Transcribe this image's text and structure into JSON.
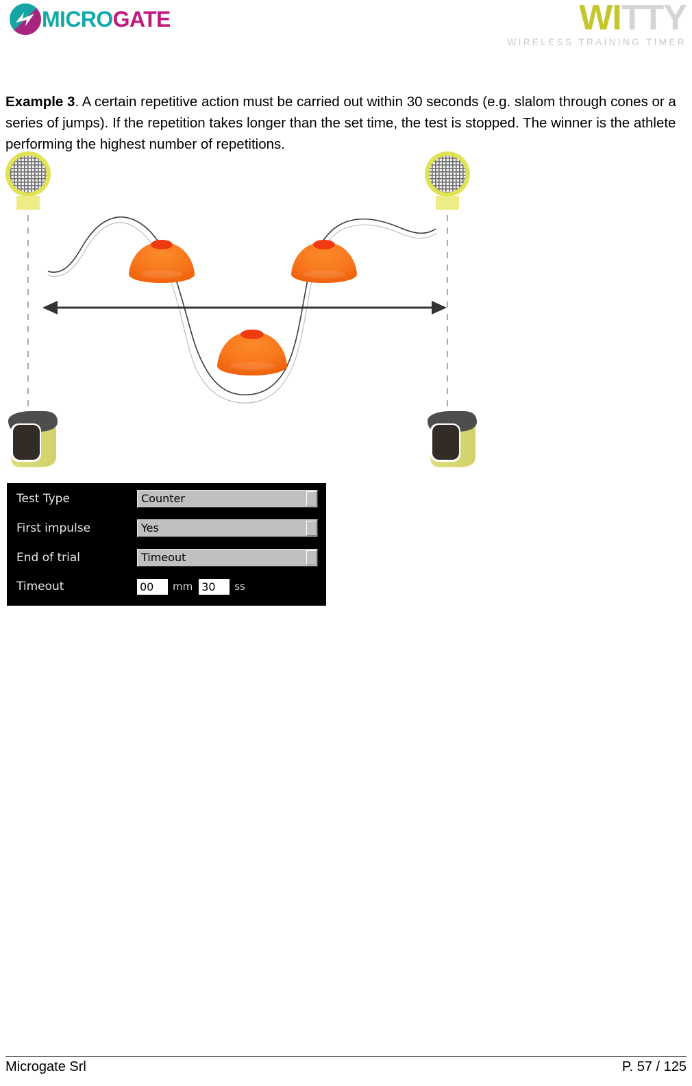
{
  "header": {
    "microgate": {
      "icon": "microgate-circle-bolt-icon",
      "word_part_1": "MICRO",
      "word_part_2": "GATE",
      "color_teal": "#12a9a9",
      "color_magenta": "#c2187f"
    },
    "witty": {
      "word_part_1": "WI",
      "word_part_2": "TTY",
      "tagline": "WIRELESS TRAINING TIMER",
      "color_yellow": "#c4c62b",
      "color_gray": "#d4d4d4"
    }
  },
  "content": {
    "example_label": "Example 3",
    "paragraph": ". A certain repetitive action must be carried out within 30 seconds (e.g. slalom through cones or a series of jumps). If the repetition takes longer than the set time, the test is stopped. The winner is the athlete performing the highest number of repetitions."
  },
  "illustration": {
    "description": "slalom-drill-diagram",
    "reflector_icon": "reflector-panel-icon",
    "photocell_icon": "photocell-sensor-icon",
    "cone_icon": "training-cone-icon",
    "path_icon": "slalom-path-icon",
    "arrow_icon": "double-headed-arrow-icon",
    "beam_icon": "dashed-beam-line-icon",
    "cone_color": "#f8771d",
    "cone_top_color": "#f03a10",
    "device_yellow": "#dcdc78",
    "reflector_ring_color": "#e2e257",
    "photocell_cap_color": "#4d4d4d",
    "photocell_lens_color": "#332b26"
  },
  "settings": {
    "rows": [
      {
        "label": "Test Type",
        "value": "Counter",
        "type": "dropdown"
      },
      {
        "label": "First impulse",
        "value": "Yes",
        "type": "dropdown"
      },
      {
        "label": "End of trial",
        "value": "Timeout",
        "type": "dropdown"
      }
    ],
    "timeout": {
      "label": "Timeout",
      "minutes_value": "00",
      "minutes_unit": "mm",
      "seconds_value": "30",
      "seconds_unit": "ss"
    }
  },
  "footer": {
    "company": "Microgate Srl",
    "page": "P. 57 / 125"
  }
}
